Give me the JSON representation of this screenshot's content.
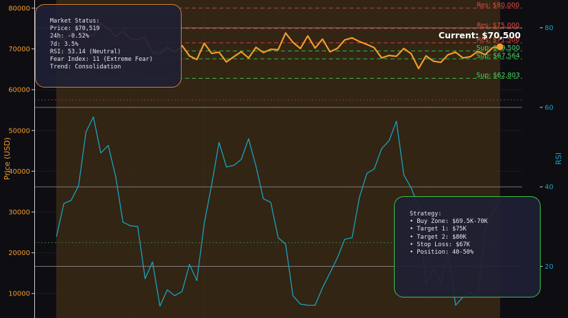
{
  "chart_data": {
    "type": "line",
    "xlim": [
      -3,
      63
    ],
    "price_axis": {
      "label": "Price (USD)",
      "ylim": [
        4000,
        82000
      ],
      "ticks": [
        10000,
        20000,
        30000,
        40000,
        50000,
        60000,
        70000,
        80000
      ],
      "tick_labels": [
        "10000",
        "20000",
        "30000",
        "40000",
        "50000",
        "60000",
        "70000",
        "80000"
      ]
    },
    "rsi_axis": {
      "label": "RSI",
      "ylim": [
        7,
        87
      ],
      "ticks": [
        20,
        40,
        60,
        80
      ],
      "tick_labels": [
        "20",
        "40",
        "60",
        "80"
      ]
    },
    "grid": true,
    "series": [
      {
        "axis": "price",
        "color": "#f39c2c",
        "x": [
          0,
          1,
          2,
          3,
          4,
          5,
          6,
          7,
          8,
          9,
          10,
          11,
          12,
          13,
          14,
          15,
          16,
          17,
          18,
          19,
          20,
          21,
          22,
          23,
          24,
          25,
          26,
          27,
          28,
          29,
          30,
          31,
          32,
          33,
          34,
          35,
          36,
          37,
          38,
          39,
          40,
          41,
          42,
          43,
          44,
          45,
          46,
          47,
          48,
          49,
          50,
          51,
          52,
          53,
          54,
          55,
          56,
          57,
          58,
          59,
          60
        ],
        "values": [
          72800,
          72200,
          73900,
          75400,
          73100,
          73400,
          76200,
          75000,
          73000,
          74300,
          72600,
          72300,
          72900,
          69100,
          68900,
          70400,
          69200,
          70800,
          68300,
          67400,
          71400,
          68900,
          69200,
          66800,
          68100,
          69300,
          67800,
          70400,
          69100,
          69900,
          69800,
          73900,
          71600,
          70100,
          73200,
          70200,
          72400,
          69300,
          70100,
          72200,
          72700,
          71800,
          71100,
          70300,
          67800,
          68400,
          68200,
          70100,
          68800,
          65200,
          68300,
          67000,
          66700,
          68600,
          69200,
          67800,
          68100,
          69400,
          68600,
          70300,
          70519
        ]
      },
      {
        "axis": "rsi",
        "color": "#1aa3c4",
        "x": [
          0,
          1,
          2,
          3,
          4,
          5,
          6,
          7,
          8,
          9,
          10,
          11,
          12,
          13,
          14,
          15,
          16,
          17,
          18,
          19,
          20,
          21,
          22,
          23,
          24,
          25,
          26,
          27,
          28,
          29,
          30,
          31,
          32,
          33,
          34,
          35,
          36,
          37,
          38,
          39,
          40,
          41,
          42,
          43,
          44,
          45,
          46,
          47,
          48,
          49,
          50,
          51,
          52,
          53,
          54,
          55,
          56,
          57,
          58,
          59,
          60
        ],
        "values": [
          27.5,
          35.8,
          36.6,
          40.3,
          53.8,
          57.6,
          48.5,
          50.4,
          42.7,
          31.1,
          30.2,
          30.0,
          16.9,
          21.1,
          10.0,
          14.1,
          12.6,
          13.7,
          20.5,
          16.4,
          30.8,
          40.5,
          51.2,
          45.0,
          45.4,
          46.9,
          52.1,
          45.2,
          37.0,
          36.1,
          27.2,
          25.6,
          12.6,
          10.5,
          10.2,
          10.2,
          14.6,
          18.3,
          22.1,
          26.8,
          27.2,
          37.4,
          43.4,
          44.5,
          49.6,
          51.6,
          56.5,
          43.0,
          39.7,
          35.0,
          15.7,
          19.3,
          16.0,
          23.6,
          10.2,
          12.3,
          13.4,
          12.3,
          29.7,
          33.5,
          36.4
        ]
      }
    ],
    "horizontal_lines": [
      {
        "axis": "price",
        "value": 80000,
        "color": "#d9433f",
        "style": "dashed",
        "label": "Res: $80,000",
        "label_color": "#e74c3c"
      },
      {
        "axis": "price",
        "value": 75000,
        "color": "#d9433f",
        "style": "dashed",
        "label": "Res: $75,000",
        "label_color": "#e74c3c"
      },
      {
        "axis": "price",
        "value": 71500,
        "color": "#d9433f",
        "style": "dashed",
        "label": "Res: $71,500",
        "label_color": "#e74c3c"
      },
      {
        "axis": "price",
        "value": 69500,
        "color": "#3bc64a",
        "style": "dashed",
        "label": "Sup: $69,500",
        "label_color": "#4cd964"
      },
      {
        "axis": "price",
        "value": 67564,
        "color": "#3bc64a",
        "style": "dashed",
        "label": "Sup: $67,564",
        "label_color": "#4cd964"
      },
      {
        "axis": "price",
        "value": 62803,
        "color": "#3bc64a",
        "style": "dashed",
        "label": "Sup: $62,803",
        "label_color": "#4cd964"
      },
      {
        "axis": "price",
        "value": 57500,
        "color": "#b8322f",
        "style": "dotted",
        "label": ""
      },
      {
        "axis": "price",
        "value": 22500,
        "color": "#3c8d43",
        "style": "dotted",
        "label": ""
      },
      {
        "axis": "rsi",
        "value": 80,
        "color": "#9a9aa4",
        "style": "solid",
        "label": ""
      },
      {
        "axis": "rsi",
        "value": 60,
        "color": "#9a9aa4",
        "style": "solid",
        "label": ""
      },
      {
        "axis": "rsi",
        "value": 40,
        "color": "#9a9aa4",
        "style": "solid",
        "label": ""
      },
      {
        "axis": "rsi",
        "value": 20,
        "color": "#9a9aa4",
        "style": "solid",
        "label": ""
      }
    ],
    "zone": {
      "x": [
        0,
        60
      ],
      "color": "#3a2a14"
    },
    "current_marker": {
      "x": 60,
      "value": 70519,
      "color": "#f39c2c",
      "label": "Current: $70,500"
    },
    "annotations": {
      "market_status": [
        "Market Status:",
        "Price: $70,519",
        "24h: -0.52%",
        "7d: 3.5%",
        "RSI: 53.14 (Neutral)",
        "Fear Index: 11 (Extreme Fear)",
        "Trend: Consolidation"
      ],
      "strategy": [
        "Strategy:",
        "• Buy Zone: $69.5K-70K",
        "• Target 1: $75K",
        "• Target 2: $80K",
        "• Stop Loss: $67K",
        "• Position: 40-50%"
      ]
    }
  }
}
